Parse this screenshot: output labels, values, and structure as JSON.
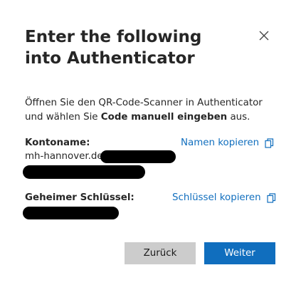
{
  "dialog": {
    "title": "Enter the following into Authenticator",
    "close_icon": "close-icon",
    "instruction": {
      "part1": "Öffnen Sie den QR-Code-Scanner in Authenticator und wählen Sie ",
      "bold": "Code manuell eingeben",
      "part2": " aus."
    }
  },
  "account": {
    "label": "Kontoname:",
    "value_visible": "mh-hannover.de",
    "copy_label": "Namen kopieren",
    "copy_icon": "copy-icon"
  },
  "secret": {
    "label": "Geheimer Schlüssel:",
    "copy_label": "Schlüssel kopieren",
    "copy_icon": "copy-icon"
  },
  "buttons": {
    "back_label": "Zurück",
    "next_label": "Weiter"
  },
  "colors": {
    "accent": "#106ebe",
    "secondary_button": "#cccccc",
    "redaction": "#000000"
  }
}
